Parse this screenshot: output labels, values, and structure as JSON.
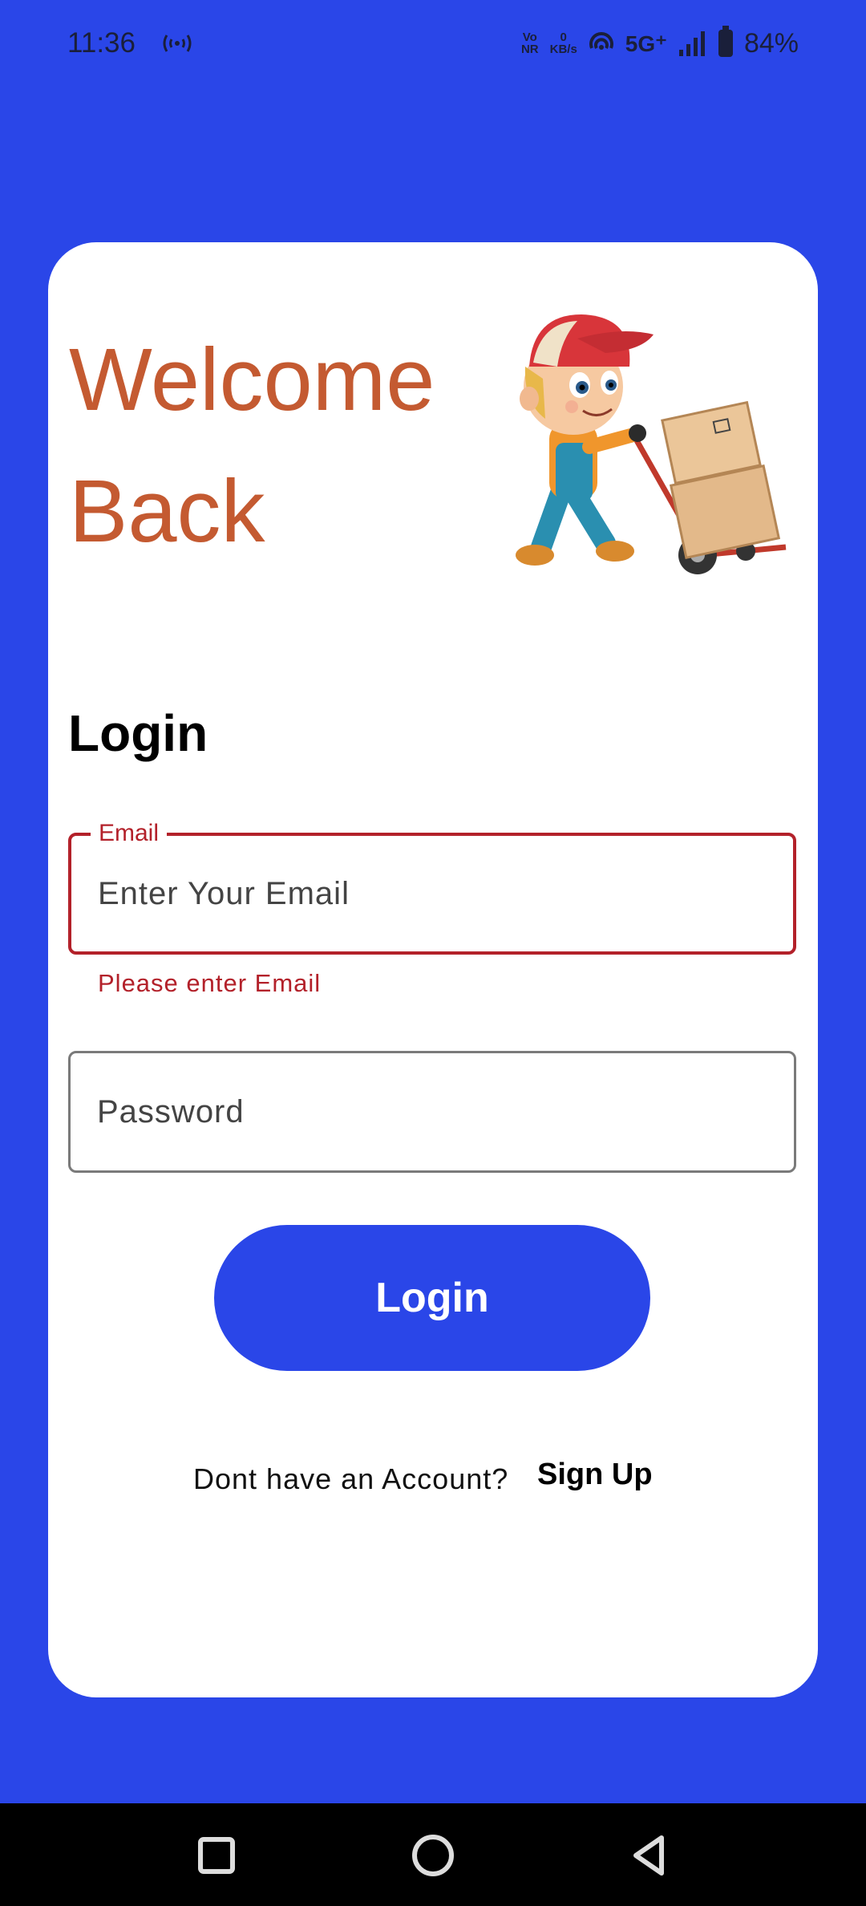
{
  "status_bar": {
    "time": "11:36",
    "volte_top": "Vo",
    "volte_bottom": "NR",
    "speed_value": "0",
    "speed_unit": "KB/s",
    "network": "5G⁺",
    "battery": "84%"
  },
  "welcome": {
    "line1": "Welcome",
    "line2": "Back"
  },
  "mascot_icon": "delivery-boy-with-hand-truck",
  "login_title": "Login",
  "email": {
    "label": "Email",
    "placeholder": "Enter Your Email",
    "value": "",
    "error": "Please enter Email"
  },
  "password": {
    "placeholder": "Password",
    "value": ""
  },
  "login_button": "Login",
  "signup": {
    "question": "Dont have an Account?",
    "link": "Sign Up"
  },
  "colors": {
    "brand_blue": "#2a46e8",
    "welcome_orange": "#c45a31",
    "error_red": "#b3212a"
  }
}
